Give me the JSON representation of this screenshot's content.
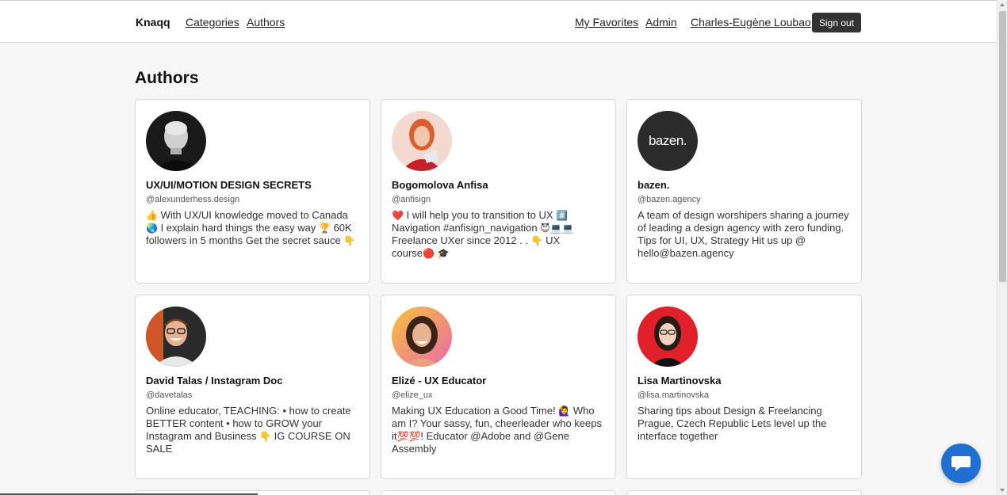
{
  "header": {
    "brand": "Knaqq",
    "nav": {
      "categories": "Categories",
      "authors": "Authors"
    },
    "right": {
      "favorites": "My Favorites",
      "admin": "Admin",
      "user": "Charles-Eugène Loubao",
      "signout": "Sign out"
    }
  },
  "page": {
    "title": "Authors"
  },
  "authors": [
    {
      "name": "UX/UI/MOTION DESIGN SECRETS",
      "handle": "@alexunderhess.design",
      "bio_parts": [
        "👍",
        " With UX/UI knowledge moved to Canada ",
        "🌏",
        " I explain hard things the easy way ",
        "🏆",
        " 60K followers in 5 months Get the secret sauce ",
        "👇"
      ]
    },
    {
      "name": "Bogomolova Anfisa",
      "handle": "@anfisign",
      "bio_parts": [
        "❤️",
        " I will help you to transition to UX ",
        "#️⃣",
        " Navigation #anfisign_navigation ",
        "😈💻💻",
        " Freelance UXer since 2012 . . ",
        "👇",
        " UX course",
        "🔴",
        " ",
        "🎓"
      ]
    },
    {
      "name": "bazen.",
      "handle": "@bazen.agency",
      "bio_parts": [
        "A team of design worshipers sharing a journey of leading a design agency with zero funding. Tips for UI, UX, Strategy Hit us up @ hello@bazen.agency"
      ],
      "logo_text": "bazen."
    },
    {
      "name": "David Talas / Instagram Doc",
      "handle": "@davetalas",
      "bio_parts": [
        "Online educator, TEACHING: • how to create BETTER content • how to GROW your Instagram and Business ",
        "👇",
        " IG COURSE ON SALE"
      ]
    },
    {
      "name": "Elizé - UX Educator",
      "handle": "@elize_ux",
      "bio_parts": [
        "Making UX Education a Good Time! ",
        "🙋‍♀️",
        " Who am I? Your sassy, fun, cheerleader who keeps it",
        "💯💯",
        "! Educator @Adobe and @Gene Assembly"
      ]
    },
    {
      "name": "Lisa Martinovska",
      "handle": "@lisa.martinovska",
      "bio_parts": [
        "Sharing tips about Design & Freelancing Prague, Czech Republic Lets level up the interface together"
      ]
    }
  ],
  "icons": {
    "chat": "chat-bubble-icon"
  },
  "colors": {
    "chat_button": "#1f6fd1",
    "signout_bg": "#333333"
  }
}
